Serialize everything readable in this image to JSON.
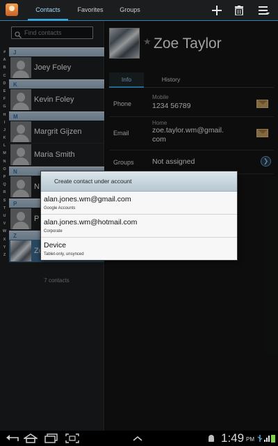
{
  "colors": {
    "accent": "#3aa2db",
    "section_header": "#b9cde0",
    "selected_row": "#3e6f95",
    "dialog_bg": "#f7f7f7"
  },
  "topbar": {
    "app_icon": "contacts-app-icon",
    "tabs": [
      {
        "label": "Contacts",
        "active": true
      },
      {
        "label": "Favorites",
        "active": false
      },
      {
        "label": "Groups",
        "active": false
      }
    ],
    "actions": [
      "add-icon",
      "delete-icon",
      "menu-icon"
    ]
  },
  "contact_list": {
    "search_placeholder": "Find contacts",
    "index_letters": [
      "#",
      "A",
      "B",
      "C",
      "D",
      "E",
      "F",
      "G",
      "H",
      "I",
      "J",
      "K",
      "L",
      "M",
      "N",
      "O",
      "P",
      "Q",
      "R",
      "S",
      "T",
      "U",
      "V",
      "W",
      "X",
      "Y",
      "Z"
    ],
    "sections": [
      {
        "letter": "J",
        "contacts": [
          "Joey Foley"
        ]
      },
      {
        "letter": "K",
        "contacts": [
          "Kevin Foley"
        ]
      },
      {
        "letter": "M",
        "contacts": [
          "Margrit Gijzen",
          "Maria Smith"
        ]
      },
      {
        "letter": "N",
        "contacts": [
          "N"
        ]
      },
      {
        "letter": "P",
        "contacts": [
          "P"
        ]
      },
      {
        "letter": "Z",
        "contacts": [
          "Zo"
        ]
      }
    ],
    "count_label": "7 contacts"
  },
  "detail": {
    "name": "Zoe Taylor",
    "tabs": [
      {
        "label": "Info",
        "active": true
      },
      {
        "label": "History",
        "active": false
      }
    ],
    "phone": {
      "label": "Phone",
      "type": "Mobile",
      "value": "1234 56789"
    },
    "email": {
      "label": "Email",
      "type": "Home",
      "value_line1": "zoe.taylor.wm@gmail.",
      "value_line2": "com"
    },
    "groups": {
      "label": "Groups",
      "value": "Not assigned"
    }
  },
  "dialog": {
    "title": "Create contact under account",
    "accounts": [
      {
        "name": "alan.jones.wm@gmail.com",
        "type": "Google Accounts"
      },
      {
        "name": "alan.jones.wm@hotmail.com",
        "type": "Corporate"
      },
      {
        "name": "Device",
        "type": "Tablet-only, unsynced"
      }
    ]
  },
  "system_bar": {
    "time": "1:49",
    "ampm": "PM"
  }
}
